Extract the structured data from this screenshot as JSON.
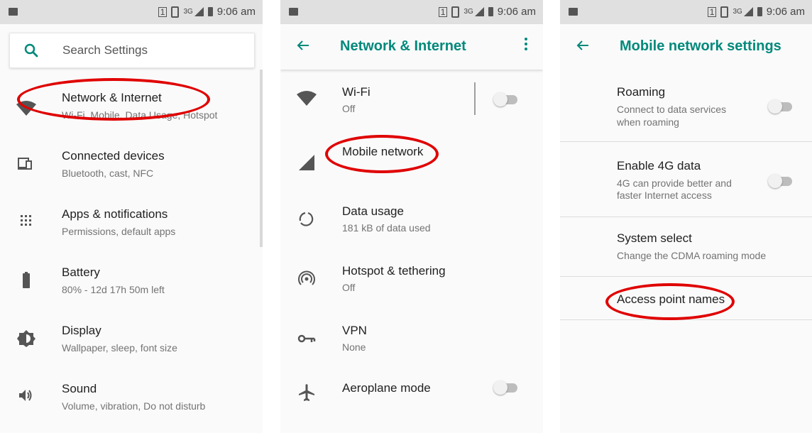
{
  "status": {
    "sim_label": "1",
    "network_label": "3G",
    "time": "9:06 am"
  },
  "screen1": {
    "search_placeholder": "Search Settings",
    "items": [
      {
        "title": "Network & Internet",
        "subtitle": "Wi-Fi, Mobile, Data Usage, Hotspot",
        "icon": "wifi-icon"
      },
      {
        "title": "Connected devices",
        "subtitle": "Bluetooth, cast, NFC",
        "icon": "devices-icon"
      },
      {
        "title": "Apps & notifications",
        "subtitle": "Permissions, default apps",
        "icon": "apps-grid-icon"
      },
      {
        "title": "Battery",
        "subtitle": "80% - 12d 17h 50m left",
        "icon": "battery-icon"
      },
      {
        "title": "Display",
        "subtitle": "Wallpaper, sleep, font size",
        "icon": "brightness-icon"
      },
      {
        "title": "Sound",
        "subtitle": "Volume, vibration, Do not disturb",
        "icon": "volume-icon"
      }
    ]
  },
  "screen2": {
    "title": "Network & Internet",
    "items": [
      {
        "title": "Wi-Fi",
        "subtitle": "Off",
        "icon": "wifi-icon"
      },
      {
        "title": "Mobile network",
        "icon": "signal-icon"
      },
      {
        "title": "Data usage",
        "subtitle": "181 kB of data used",
        "icon": "data-usage-icon"
      },
      {
        "title": "Hotspot & tethering",
        "subtitle": "Off",
        "icon": "hotspot-icon"
      },
      {
        "title": "VPN",
        "subtitle": "None",
        "icon": "vpn-key-icon"
      },
      {
        "title": "Aeroplane mode",
        "icon": "airplane-icon"
      }
    ]
  },
  "screen3": {
    "title": "Mobile network settings",
    "items": [
      {
        "title": "Roaming",
        "subtitle_line1": "Connect to data services",
        "subtitle_line2": "when roaming"
      },
      {
        "title": "Enable 4G data",
        "subtitle_line1": "4G can provide better and",
        "subtitle_line2": "faster Internet access"
      },
      {
        "title": "System select",
        "subtitle_line1": "Change the CDMA roaming mode"
      },
      {
        "title": "Access point names"
      }
    ]
  },
  "colors": {
    "accent": "#00897b",
    "highlight": "#e00000",
    "statusbar": "#e0e0e0"
  }
}
